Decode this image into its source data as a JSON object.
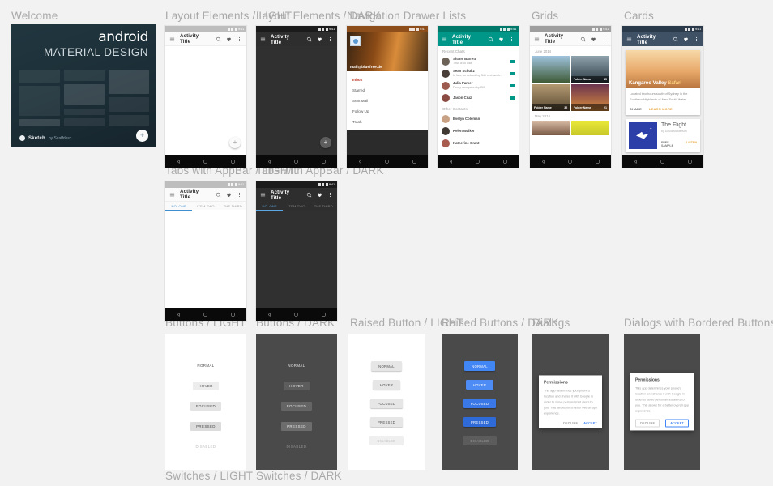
{
  "page": {
    "background": "#f2f2f2"
  },
  "sections": [
    {
      "label": "Welcome"
    },
    {
      "label": "Layout Elements / LIGHT"
    },
    {
      "label": "Layout Elements / DARK"
    },
    {
      "label": "Navigation Drawer Lists"
    },
    {
      "label": "Grids"
    },
    {
      "label": "Cards"
    },
    {
      "label": "Tabs with AppBar / LIGHT"
    },
    {
      "label": "Tabs with AppBar / DARK"
    },
    {
      "label": "Buttons / LIGHT"
    },
    {
      "label": "Buttons / DARK"
    },
    {
      "label": "Raised Button / LIGHT"
    },
    {
      "label": "Raised Buttons / DARK"
    },
    {
      "label": "Dialogs"
    },
    {
      "label": "Dialogs with Bordered Buttons"
    },
    {
      "label": "Switches / LIGHT"
    },
    {
      "label": "Switches / DARK"
    }
  ],
  "welcome": {
    "logo_primary": "android",
    "logo_secondary": "MATERIAL DESIGN",
    "footer_brand": "Sketch",
    "footer_sub": "by Scaffdesc"
  },
  "statusbar": {
    "time": "9:41"
  },
  "appbar": {
    "title": "Activity Title",
    "icons": [
      "menu-icon",
      "search-icon",
      "heart-icon",
      "overflow-icon"
    ]
  },
  "navbar": {
    "items": [
      "back-icon",
      "home-icon",
      "recents-icon"
    ]
  },
  "fab": {
    "glyph": "+"
  },
  "drawer": {
    "account_email": "mail@bluefree.de",
    "items": [
      {
        "label": "Inbox",
        "active": true
      },
      {
        "label": "Starred",
        "active": false
      },
      {
        "label": "Sent Mail",
        "active": false
      },
      {
        "label": "Follow Up",
        "active": false
      },
      {
        "label": "Trash",
        "active": false
      }
    ]
  },
  "lists": {
    "section_recent": "Recent Chats",
    "section_other": "Other Contacts",
    "recent": [
      {
        "name": "Shane Barrett",
        "sub": "Thur, 8:00 wait",
        "avatar": "#6d6258"
      },
      {
        "name": "Sean Schultz",
        "sub": "Is here for debunking 345 next week...",
        "avatar": "#4a3f38"
      },
      {
        "name": "Julia Parker",
        "sub": "Funny sandpaper by Cliff",
        "avatar": "#9c5b4e"
      },
      {
        "name": "Jason Cruz",
        "sub": "",
        "avatar": "#8a4b42"
      }
    ],
    "other": [
      {
        "name": "Evelyn Coleman",
        "avatar": "#c8a184"
      },
      {
        "name": "Helen Walker",
        "avatar": "#3f3833"
      },
      {
        "name": "Katherine Grant",
        "avatar": "#a85c50"
      }
    ]
  },
  "grids": {
    "section_june": "June 2014",
    "section_may": "May 2014",
    "cells": [
      {
        "label": "",
        "count": "",
        "c1": "#9fc3dd",
        "c2": "#3f5a36"
      },
      {
        "label": "Folder Name",
        "count": "45",
        "c1": "#8fa3ad",
        "c2": "#2c3b44"
      },
      {
        "label": "Folder Name",
        "count": "32",
        "c1": "#b39a72",
        "c2": "#5a4a33"
      },
      {
        "label": "Folder Name",
        "count": "21",
        "c1": "#6b3550",
        "c2": "#d98b3c"
      }
    ],
    "cells_may": [
      {
        "c1": "#d8bca6",
        "c2": "#7a5a46"
      },
      {
        "c1": "#e8e83a",
        "c2": "#c8c82a"
      }
    ]
  },
  "cards": {
    "card1": {
      "title_main": "Kangaroo Valley",
      "title_accent": "Safari",
      "body": "Located two hours south of Sydney in the Southern Highlands of New South Wales...",
      "action_share": "SHARE",
      "action_learn": "LEARN MORE"
    },
    "card2": {
      "title": "The Flight",
      "subtitle": "by David Masterson",
      "action_sample": "FREE SAMPLE",
      "action_listen": "LISTEN"
    }
  },
  "tabs": {
    "items": [
      "NO. ONE",
      "ITEM TWO",
      "THE THIRD"
    ],
    "selected_index": 0
  },
  "buttons": {
    "flat": [
      {
        "label": "NORMAL",
        "state": "normal"
      },
      {
        "label": "HOVER",
        "state": "hov"
      },
      {
        "label": "FOCUSED",
        "state": "foc"
      },
      {
        "label": "PRESSED",
        "state": "pre"
      },
      {
        "label": "DISABLED",
        "state": "dis"
      }
    ],
    "raised": [
      {
        "label": "NORMAL",
        "state": "normal"
      },
      {
        "label": "HOVER",
        "state": "h"
      },
      {
        "label": "FOCUSED",
        "state": "f"
      },
      {
        "label": "PRESSED",
        "state": "p"
      },
      {
        "label": "DISABLED",
        "state": "dis"
      }
    ]
  },
  "dialog": {
    "title": "Permissions",
    "body": "This app determines your phone's location and shares it with Google in order to serve personalized alerts to you. This allows for a better overall app experience.",
    "decline": "DECLINE",
    "accept": "ACCEPT"
  },
  "colors": {
    "accent_teal": "#009688",
    "accent_blue": "#4285f4",
    "accent_amber": "#e8a33d",
    "label_grey": "#a9a9a9"
  }
}
